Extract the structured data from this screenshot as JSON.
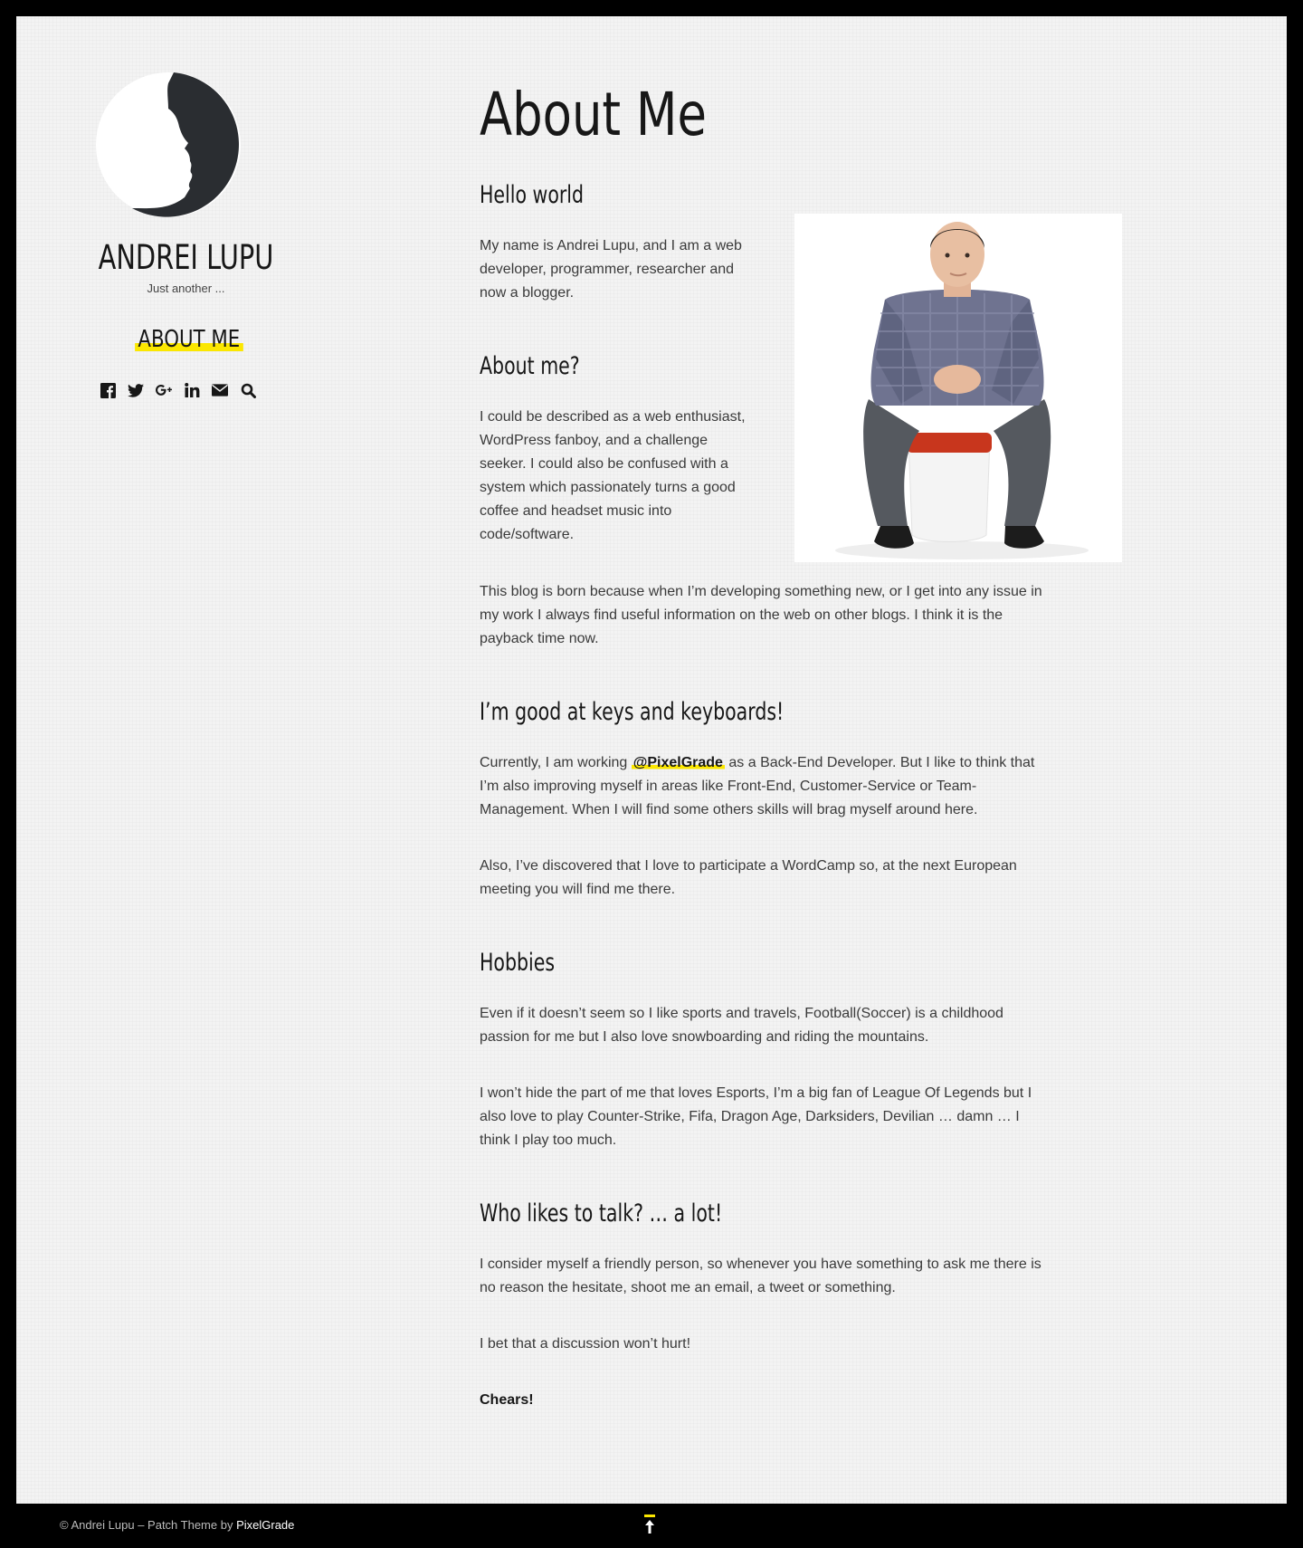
{
  "site": {
    "title": "ANDREI LUPU",
    "tagline": "Just another ..."
  },
  "nav": {
    "about_label": "ABOUT ME"
  },
  "social_icons": [
    "facebook-icon",
    "twitter-icon",
    "google-plus-icon",
    "linkedin-icon",
    "email-icon",
    "search-icon"
  ],
  "page": {
    "title": "About Me",
    "sections": {
      "hello": {
        "heading": "Hello world",
        "p1": "My name is Andrei Lupu, and I am a web developer, programmer, researcher and now a blogger."
      },
      "about": {
        "heading": "About me?",
        "p1": "I could be described as a web enthusiast, WordPress fanboy, and a challenge seeker. I could also be confused with a system which passionately turns a good coffee and headset music into code/software.",
        "p2": "This blog is born because when I’m developing something new, or I get into any issue in my work I always find useful information on the web on other blogs. I think it is the payback time now."
      },
      "keys": {
        "heading": "I’m good at keys and keyboards!",
        "p1_before": "Currently, I am working ",
        "p1_link": "@PixelGrade",
        "p1_after": " as a Back-End Developer. But I like to think that I’m also improving myself in areas like Front-End, Customer-Service or Team-Management. When I will find some others skills will brag myself around here.",
        "p2": "Also, I’ve discovered that I love to participate a WordCamp so, at the next European meeting you will find me there."
      },
      "hobbies": {
        "heading": "Hobbies",
        "p1": "Even if it doesn’t seem so I like sports and travels, Football(Soccer) is a childhood passion for me but I also love snowboarding and riding the mountains.",
        "p2": "I won’t hide the part of me that loves Esports, I’m a big fan of League Of Legends but I also love to play Counter-Strike, Fifa, Dragon Age, Darksiders, Devilian … damn … I think I play too much."
      },
      "talk": {
        "heading": "Who likes to talk? … a lot!",
        "p1": "I consider myself a friendly person, so whenever you have something to ask me there is no reason the hesitate, shoot me an email, a tweet or something.",
        "p2": "I bet that a discussion won’t hurt!",
        "p3": "Chears!"
      }
    }
  },
  "footer": {
    "text": "© Andrei Lupu – Patch Theme by ",
    "link": "PixelGrade"
  },
  "colors": {
    "accent": "#fbe700",
    "text_dark": "#171717",
    "background": "#f3f3f3",
    "frame": "#000000"
  }
}
